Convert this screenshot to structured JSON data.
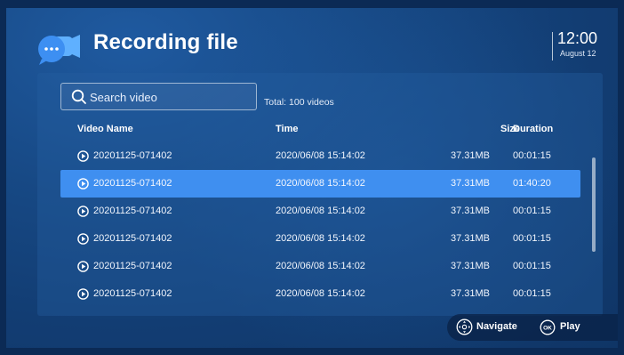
{
  "header": {
    "title": "Recording file",
    "app_icon": "video-chat-icon",
    "clock_time": "12:00",
    "clock_date": "August 12"
  },
  "search": {
    "placeholder": "Search video",
    "value": "",
    "icon": "search-icon"
  },
  "total_label": "Total: 100 videos",
  "columns": {
    "name": "Video Name",
    "time": "Time",
    "size": "Size",
    "duration": "Duration"
  },
  "rows": [
    {
      "name": "20201125-071402",
      "time": "2020/06/08  15:14:02",
      "size": "37.31MB",
      "duration": "00:01:15",
      "selected": false
    },
    {
      "name": "20201125-071402",
      "time": "2020/06/08  15:14:02",
      "size": "37.31MB",
      "duration": "01:40:20",
      "selected": true
    },
    {
      "name": "20201125-071402",
      "time": "2020/06/08  15:14:02",
      "size": "37.31MB",
      "duration": "00:01:15",
      "selected": false
    },
    {
      "name": "20201125-071402",
      "time": "2020/06/08  15:14:02",
      "size": "37.31MB",
      "duration": "00:01:15",
      "selected": false
    },
    {
      "name": "20201125-071402",
      "time": "2020/06/08  15:14:02",
      "size": "37.31MB",
      "duration": "00:01:15",
      "selected": false
    },
    {
      "name": "20201125-071402",
      "time": "2020/06/08  15:14:02",
      "size": "37.31MB",
      "duration": "00:01:15",
      "selected": false
    }
  ],
  "hints": {
    "navigate_label": "Navigate",
    "navigate_icon": "dpad-icon",
    "play_label": "Play",
    "play_icon": "ok-button-icon"
  },
  "colors": {
    "background": "#174985",
    "selected_row": "#3f8ff0",
    "accent": "#4aa6f5"
  }
}
